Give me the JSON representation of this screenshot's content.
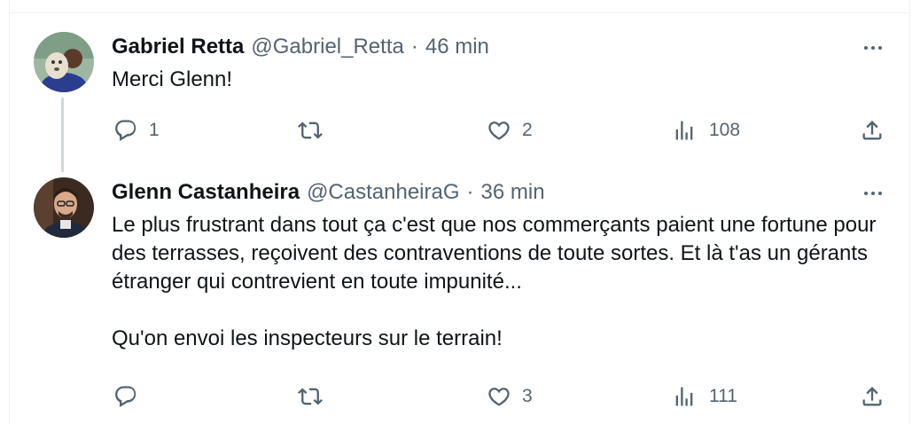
{
  "tweets": [
    {
      "author": "Gabriel Retta",
      "handle": "@Gabriel_Retta",
      "separator": "·",
      "time": "46 min",
      "text": [
        "Merci Glenn!"
      ],
      "reply_count": "1",
      "retweet_count": "",
      "like_count": "2",
      "view_count": "108",
      "avatar_icon": "avatar-photo-man-with-dog"
    },
    {
      "author": "Glenn Castanheira",
      "handle": "@CastanheiraG",
      "separator": "·",
      "time": "36 min",
      "text": [
        "Le plus frustrant dans tout ça c'est que nos commerçants paient une fortune pour des terrasses, reçoivent des contraventions de toute sortes. Et là t'as un gérants étranger qui contrevient en toute impunité...",
        "Qu'on envoi les inspecteurs sur le terrain!"
      ],
      "reply_count": "",
      "retweet_count": "",
      "like_count": "3",
      "view_count": "111",
      "avatar_icon": "avatar-photo-man-with-glasses"
    }
  ],
  "icons": {
    "reply": "reply-icon",
    "retweet": "retweet-icon",
    "like": "heart-icon",
    "views": "views-icon",
    "share": "share-icon",
    "more": "more-icon"
  },
  "colors": {
    "text": "#0f1419",
    "secondary": "#536471",
    "divider": "#eff3f4",
    "thread_line": "#cfd9de"
  }
}
